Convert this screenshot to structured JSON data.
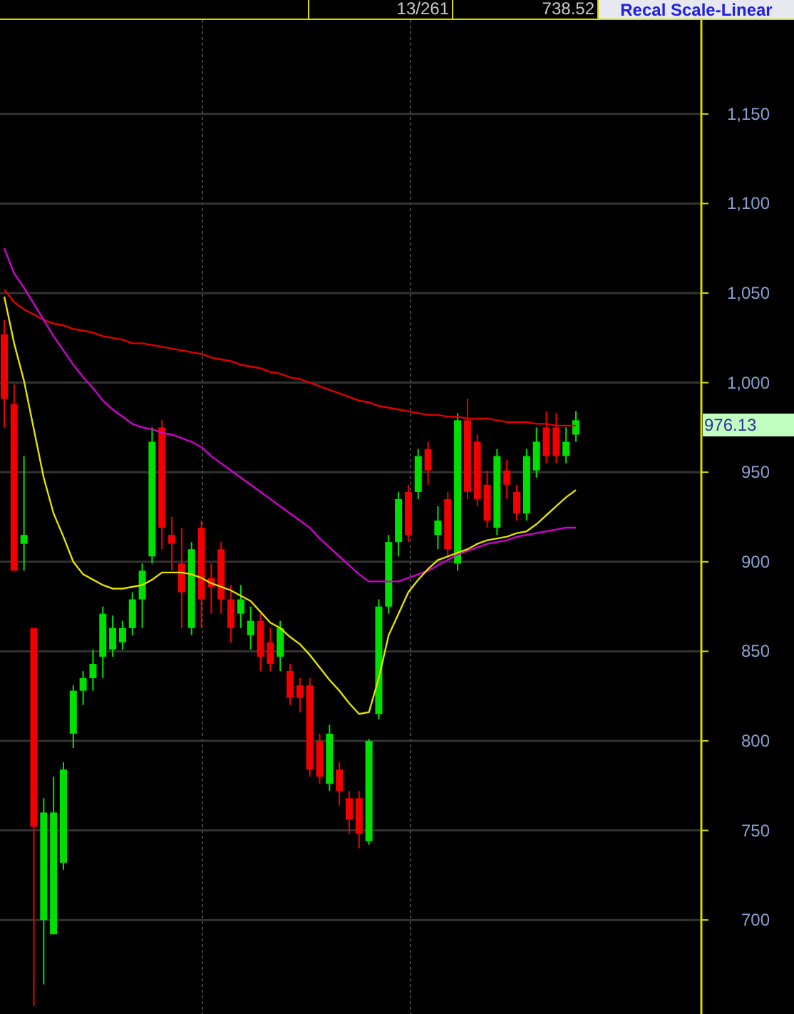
{
  "toolbar": {
    "cells": [
      "13/261",
      "738.52"
    ],
    "button": "Recal Scale-Linear"
  },
  "chart": {
    "last_price": "976.13",
    "chart_data": {
      "type": "candlestick",
      "grid": true,
      "categories": [
        null,
        null,
        null,
        null,
        null,
        null,
        null,
        null,
        null,
        null,
        null,
        null,
        null,
        null,
        null,
        null,
        null,
        null,
        null,
        null,
        null,
        null,
        null,
        null,
        null,
        null,
        null,
        null,
        null,
        null,
        null,
        null,
        null,
        null,
        null,
        null,
        null,
        null,
        null,
        null,
        null,
        null,
        null,
        null,
        null,
        null,
        null,
        null,
        null,
        null,
        null,
        null,
        null,
        null,
        null,
        null,
        null,
        null,
        null
      ],
      "ylim": [
        647.5,
        1202.5
      ],
      "yticks": [
        {
          "value": 700,
          "label": "700"
        },
        {
          "value": 750,
          "label": "750"
        },
        {
          "value": 800,
          "label": "800"
        },
        {
          "value": 850,
          "label": "850"
        },
        {
          "value": 900,
          "label": "900"
        },
        {
          "value": 950,
          "label": "950"
        },
        {
          "value": 1000,
          "label": "1,000"
        },
        {
          "value": 1050,
          "label": "1,050"
        },
        {
          "value": 1100,
          "label": "1,100"
        },
        {
          "value": 1150,
          "label": "1,150"
        }
      ],
      "ohlc": [
        [
          1027,
          1035,
          975,
          991
        ],
        [
          988,
          999,
          895,
          895
        ],
        [
          910,
          959,
          895,
          915
        ],
        [
          863,
          863,
          652,
          752
        ],
        [
          700,
          768,
          664,
          760
        ],
        [
          692,
          780,
          692,
          760
        ],
        [
          732,
          788,
          728,
          784
        ],
        [
          804,
          831,
          796,
          828
        ],
        [
          828,
          839,
          820,
          835
        ],
        [
          835,
          851,
          828,
          843
        ],
        [
          847,
          875,
          835,
          871
        ],
        [
          851,
          870,
          847,
          863
        ],
        [
          855,
          867,
          851,
          863
        ],
        [
          863,
          883,
          859,
          879
        ],
        [
          879,
          899,
          863,
          895
        ],
        [
          903,
          975,
          899,
          967
        ],
        [
          975,
          979,
          907,
          919
        ],
        [
          915,
          925,
          895,
          910
        ],
        [
          899,
          919,
          863,
          883
        ],
        [
          863,
          911,
          859,
          907
        ],
        [
          919,
          923,
          863,
          879
        ],
        [
          891,
          899,
          871,
          886
        ],
        [
          907,
          911,
          871,
          879
        ],
        [
          879,
          887,
          855,
          863
        ],
        [
          871,
          887,
          863,
          879
        ],
        [
          859,
          875,
          851,
          867
        ],
        [
          867,
          871,
          839,
          847
        ],
        [
          855,
          863,
          839,
          843
        ],
        [
          847,
          867,
          839,
          863
        ],
        [
          839,
          843,
          820,
          824
        ],
        [
          831,
          835,
          816,
          824
        ],
        [
          831,
          835,
          780,
          784
        ],
        [
          800,
          804,
          776,
          780
        ],
        [
          776,
          809,
          772,
          804
        ],
        [
          784,
          788,
          764,
          772
        ],
        [
          768,
          772,
          748,
          756
        ],
        [
          768,
          772,
          740,
          748
        ],
        [
          744,
          801,
          742,
          800
        ],
        [
          815,
          879,
          812,
          875
        ],
        [
          875,
          915,
          871,
          911
        ],
        [
          911,
          939,
          903,
          935
        ],
        [
          939,
          943,
          911,
          915
        ],
        [
          939,
          963,
          935,
          959
        ],
        [
          963,
          967,
          943,
          951
        ],
        [
          915,
          931,
          907,
          923
        ],
        [
          935,
          939,
          903,
          907
        ],
        [
          899,
          983,
          895,
          979
        ],
        [
          979,
          991,
          935,
          939
        ],
        [
          967,
          971,
          931,
          935
        ],
        [
          943,
          951,
          919,
          923
        ],
        [
          919,
          963,
          915,
          959
        ],
        [
          951,
          957,
          935,
          943
        ],
        [
          939,
          943,
          923,
          927
        ],
        [
          927,
          963,
          923,
          959
        ],
        [
          951,
          975,
          947,
          967
        ],
        [
          975,
          984,
          955,
          959
        ],
        [
          975,
          983,
          955,
          959
        ],
        [
          959,
          975,
          955,
          967
        ],
        [
          971,
          984,
          967,
          979
        ]
      ],
      "series": [
        {
          "type": "line",
          "color": "#e00000",
          "values": [
            1052,
            1045,
            1041,
            1038,
            1035,
            1033,
            1032,
            1030,
            1029,
            1028,
            1026,
            1025,
            1024,
            1022,
            1022,
            1021,
            1020,
            1019,
            1018,
            1017,
            1016,
            1014,
            1013,
            1012,
            1010,
            1009,
            1008,
            1006,
            1005,
            1003,
            1002,
            1000,
            998,
            996,
            994,
            992,
            990,
            989,
            987,
            986,
            985,
            984,
            983,
            982,
            982,
            981,
            981,
            980,
            980,
            980,
            979,
            978,
            978,
            978,
            977,
            977,
            976,
            976,
            976
          ]
        },
        {
          "type": "line",
          "color": "#d000d0",
          "values": [
            1075,
            1061,
            1053,
            1044,
            1035,
            1026,
            1018,
            1010,
            1003,
            997,
            990,
            985,
            981,
            977,
            975,
            974,
            972,
            971,
            969,
            967,
            964,
            959,
            955,
            951,
            947,
            943,
            939,
            935,
            931,
            927,
            923,
            919,
            913,
            908,
            903,
            898,
            893,
            889,
            889,
            889,
            889,
            891,
            893,
            895,
            898,
            901,
            904,
            906,
            908,
            910,
            911,
            912,
            914,
            915,
            916,
            917,
            918,
            919,
            919
          ]
        },
        {
          "type": "line",
          "color": "#e0e000",
          "values": [
            1048,
            1022,
            1001,
            974,
            947,
            927,
            914,
            900,
            893,
            890,
            887,
            885,
            885,
            886,
            887,
            890,
            894,
            894,
            894,
            893,
            891,
            888,
            886,
            884,
            881,
            878,
            872,
            866,
            863,
            858,
            854,
            848,
            841,
            834,
            828,
            821,
            815,
            816,
            835,
            859,
            871,
            883,
            890,
            896,
            901,
            903,
            905,
            907,
            910,
            912,
            913,
            914,
            916,
            917,
            921,
            926,
            931,
            936,
            940
          ]
        }
      ]
    }
  }
}
